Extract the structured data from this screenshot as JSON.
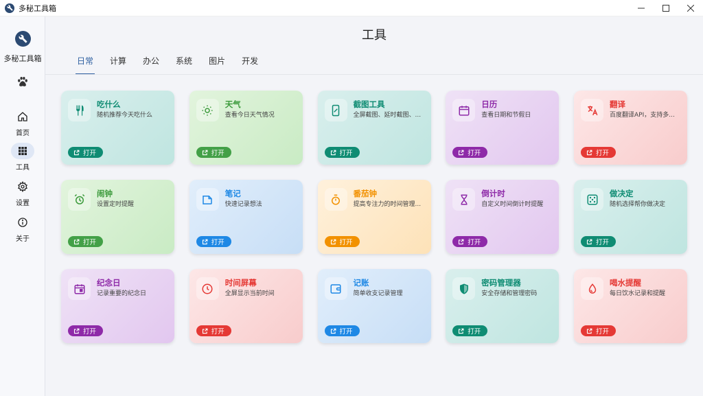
{
  "window": {
    "title": "多秘工具箱"
  },
  "sidebar": {
    "brand": "多秘工具箱",
    "nav": [
      {
        "label": "首页",
        "icon": "home-icon"
      },
      {
        "label": "工具",
        "icon": "grid-icon",
        "active": true
      },
      {
        "label": "设置",
        "icon": "gear-icon"
      },
      {
        "label": "关于",
        "icon": "info-icon"
      }
    ]
  },
  "main": {
    "title": "工具",
    "tabs": [
      {
        "label": "日常",
        "active": true
      },
      {
        "label": "计算"
      },
      {
        "label": "办公"
      },
      {
        "label": "系统"
      },
      {
        "label": "图片"
      },
      {
        "label": "开发"
      }
    ]
  },
  "cards": [
    {
      "title": "吃什么",
      "desc": "随机推荐今天吃什么",
      "button": "打开",
      "theme": "teal",
      "icon": "utensils-icon"
    },
    {
      "title": "天气",
      "desc": "查看今日天气情况",
      "button": "打开",
      "theme": "green",
      "icon": "sun-icon"
    },
    {
      "title": "截图工具",
      "desc": "全屏截图、延时截图、...",
      "button": "打开",
      "theme": "teal",
      "icon": "screenshot-icon"
    },
    {
      "title": "日历",
      "desc": "查看日期和节假日",
      "button": "打开",
      "theme": "purple",
      "icon": "calendar-icon"
    },
    {
      "title": "翻译",
      "desc": "百度翻译API，支持多...",
      "button": "打开",
      "theme": "red",
      "icon": "translate-icon"
    },
    {
      "title": "闹钟",
      "desc": "设置定时提醒",
      "button": "打开",
      "theme": "green",
      "icon": "alarm-icon"
    },
    {
      "title": "笔记",
      "desc": "快速记录想法",
      "button": "打开",
      "theme": "blue",
      "icon": "note-icon"
    },
    {
      "title": "番茄钟",
      "desc": "提高专注力的时间管理...",
      "button": "打开",
      "theme": "orange",
      "icon": "timer-icon"
    },
    {
      "title": "倒计时",
      "desc": "自定义时间倒计时提醒",
      "button": "打开",
      "theme": "purple",
      "icon": "hourglass-icon"
    },
    {
      "title": "做决定",
      "desc": "随机选择帮你做决定",
      "button": "打开",
      "theme": "teal",
      "icon": "dice-icon"
    },
    {
      "title": "纪念日",
      "desc": "记录重要的纪念日",
      "button": "打开",
      "theme": "purple",
      "icon": "event-icon"
    },
    {
      "title": "时间屏幕",
      "desc": "全屏显示当前时间",
      "button": "打开",
      "theme": "red",
      "icon": "clock-icon"
    },
    {
      "title": "记账",
      "desc": "简单收支记录管理",
      "button": "打开",
      "theme": "blue",
      "icon": "wallet-icon"
    },
    {
      "title": "密码管理器",
      "desc": "安全存储和管理密码",
      "button": "打开",
      "theme": "teal",
      "icon": "shield-icon"
    },
    {
      "title": "喝水提醒",
      "desc": "每日饮水记录和提醒",
      "button": "打开",
      "theme": "red",
      "icon": "water-drop-icon"
    }
  ]
}
